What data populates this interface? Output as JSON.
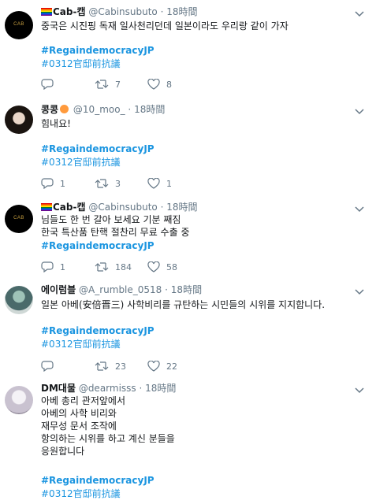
{
  "tweets": [
    {
      "name": "Cab-캡",
      "handle": "@Cabinsubuto",
      "dot": "·",
      "time": "18時間",
      "avatar_text": "CAB",
      "text": "중국은 시진핑 독재 일사천리던데 일본이라도 우리랑 같이 가자",
      "hashtags": [
        "#RegaindemocracyJP",
        "#0312官邸前抗議"
      ],
      "replies": "",
      "retweets": "7",
      "likes": "8"
    },
    {
      "name": "콩콩",
      "handle": "@10_moo_",
      "dot": "·",
      "time": "18時間",
      "text": "힘내요!",
      "hashtags": [
        "#RegaindemocracyJP",
        "#0312官邸前抗議"
      ],
      "replies": "1",
      "retweets": "3",
      "likes": "1"
    },
    {
      "name": "Cab-캡",
      "handle": "@Cabinsubuto",
      "dot": "·",
      "time": "18時間",
      "avatar_text": "CAB",
      "text": "님들도 한 번 갈아 보세요 기분 째짐\n한국 특산품 탄핵 절찬리 무료 수출 중",
      "hashtags": [
        "#RegaindemocracyJP"
      ],
      "replies": "1",
      "retweets": "184",
      "likes": "58"
    },
    {
      "name": "에이럼블",
      "handle": "@A_rumble_0518",
      "dot": "·",
      "time": "18時間",
      "text": "일본 아베(安倍晋三) 사학비리를 규탄하는 시민들의 시위를 지지합니다.",
      "hashtags": [
        "#RegaindemocracyJP",
        "#0312官邸前抗議"
      ],
      "replies": "",
      "retweets": "23",
      "likes": "22"
    },
    {
      "name": "DM대물",
      "handle": "@dearmisss",
      "dot": "·",
      "time": "18時間",
      "text": "아베 총리 관저앞에서\n아베의 사학 비리와\n재무성 문서 조작에\n항의하는 시위를 하고 계신 분들을\n응원합니다",
      "hashtags": [
        "#RegaindemocracyJP",
        "#0312官邸前抗議"
      ]
    }
  ],
  "colors": {
    "link": "#1b95e0",
    "muted": "#657786",
    "divider": "#e6ecf0"
  }
}
